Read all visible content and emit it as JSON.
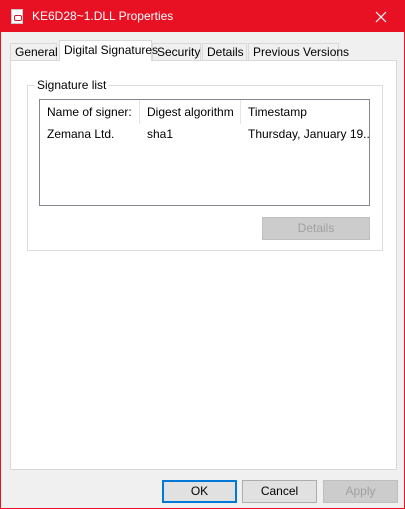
{
  "window": {
    "title": "KE6D28~1.DLL Properties",
    "accent_color": "#e81123"
  },
  "tabs": [
    {
      "label": "General"
    },
    {
      "label": "Digital Signatures"
    },
    {
      "label": "Security"
    },
    {
      "label": "Details"
    },
    {
      "label": "Previous Versions"
    }
  ],
  "active_tab": "Digital Signatures",
  "signature_list": {
    "label": "Signature list",
    "columns": [
      "Name of signer:",
      "Digest algorithm",
      "Timestamp"
    ],
    "rows": [
      {
        "signer": "Zemana Ltd.",
        "digest": "sha1",
        "timestamp": "Thursday, January 19..."
      }
    ],
    "details_label": "Details"
  },
  "footer": {
    "ok_label": "OK",
    "cancel_label": "Cancel",
    "apply_label": "Apply"
  }
}
